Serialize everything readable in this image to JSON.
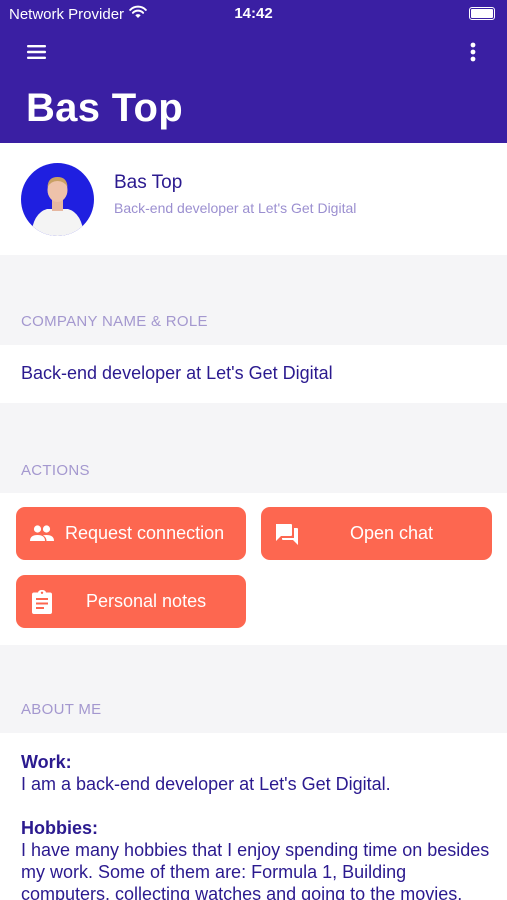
{
  "status_bar": {
    "carrier": "Network Provider",
    "time": "14:42"
  },
  "header": {
    "title": "Bas Top",
    "menu_icon": "hamburger-menu-icon",
    "more_icon": "more-vertical-icon",
    "color": "#3a1fa3"
  },
  "profile": {
    "name": "Bas Top",
    "role": "Back-end developer at Let's Get Digital"
  },
  "company_section": {
    "header": "COMPANY NAME & ROLE",
    "value": "Back-end developer at Let's Get Digital"
  },
  "actions_section": {
    "header": "ACTIONS",
    "accent": "#fd6750",
    "buttons": [
      {
        "label": "Request connection",
        "icon": "people-icon"
      },
      {
        "label": "Open chat",
        "icon": "chat-icon"
      },
      {
        "label": "Personal notes",
        "icon": "clipboard-icon"
      }
    ]
  },
  "about_section": {
    "header": "ABOUT ME",
    "work_label": "Work:",
    "work_text": "I am a back-end developer at Let's Get Digital.",
    "hobbies_label": "Hobbies:",
    "hobbies_text": "I have many hobbies that I enjoy spending time on besides my work. Some of them are: Formula 1, Building computers, collecting watches and going to the movies."
  }
}
